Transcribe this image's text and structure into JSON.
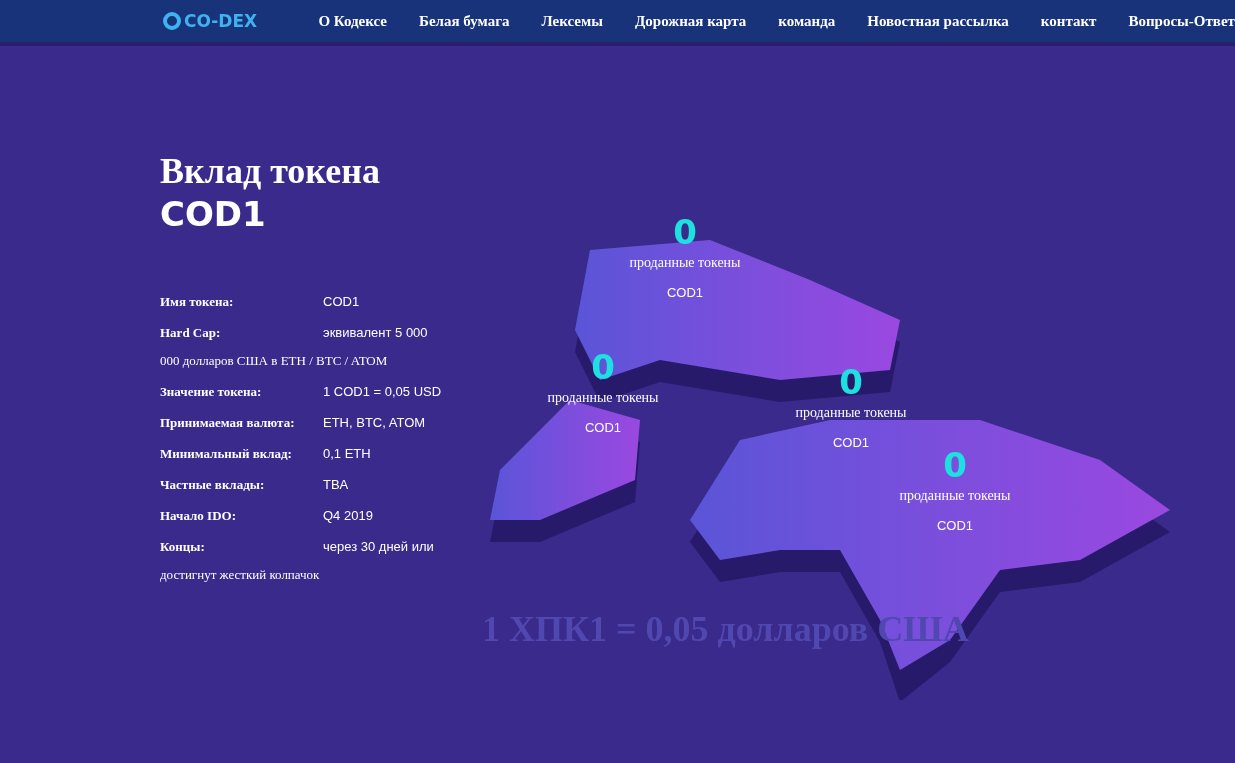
{
  "logo": {
    "text": "CO-DEX"
  },
  "nav": [
    "О Кодексе",
    "Белая бумага",
    "Лексемы",
    "Дорожная карта",
    "команда",
    "Новостная рассылка",
    "контакт",
    "Вопросы-Ответ"
  ],
  "title": "Вклад токена",
  "subtitle": "COD1",
  "details": [
    {
      "label": "Имя токена:",
      "value": "COD1"
    },
    {
      "label": "Hard Cap:",
      "value": "эквивалент 5 000",
      "cont": "000 долларов США в ETH / BTC / ATOM"
    },
    {
      "label": "Значение токена:",
      "value": "1 COD1 = 0,05 USD"
    },
    {
      "label": "Принимаемая валюта:",
      "value": "ETH, BTC, ATOM"
    },
    {
      "label": "Минимальный вклад:",
      "value": "0,1 ETH"
    },
    {
      "label": "Частные вклады:",
      "value": "TBA"
    },
    {
      "label": "Начало IDO:",
      "value": "Q4 2019"
    },
    {
      "label": "Концы:",
      "value": "через 30 дней или",
      "cont": "достигнут жесткий колпачок"
    }
  ],
  "markers": [
    {
      "count": "0",
      "label": "проданные токены",
      "token": "COD1"
    },
    {
      "count": "0",
      "label": "проданные токены",
      "token": "COD1"
    },
    {
      "count": "0",
      "label": "проданные токены",
      "token": "COD1"
    },
    {
      "count": "0",
      "label": "проданные токены",
      "token": "COD1"
    }
  ],
  "price_banner": "1 ХПК1 = 0,05 долларов США"
}
